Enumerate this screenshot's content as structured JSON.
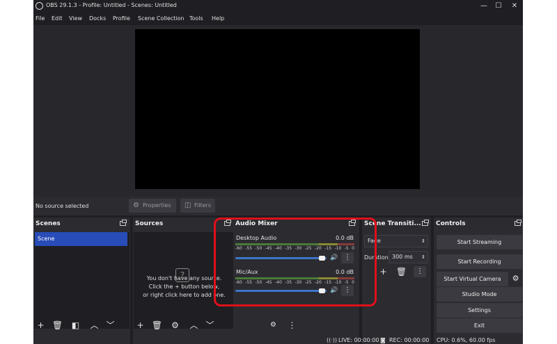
{
  "window": {
    "title": "OBS 29.1.3 - Profile: Untitled - Scenes: Untitled",
    "minimize": "—",
    "maximize": "☐",
    "close": "✕"
  },
  "menu": [
    "File",
    "Edit",
    "View",
    "Docks",
    "Profile",
    "Scene Collection",
    "Tools",
    "Help"
  ],
  "source_toolbar": {
    "no_source": "No source selected",
    "properties": "Properties",
    "filters": "Filters"
  },
  "scenes": {
    "title": "Scenes",
    "items": [
      "Scene"
    ]
  },
  "sources": {
    "title": "Sources",
    "empty_line1": "You don't have any source.",
    "empty_line2": "Click the + button below,",
    "empty_line3": "or right click here to add one."
  },
  "audio_mixer": {
    "title": "Audio Mixer",
    "scale": [
      "-60",
      "-55",
      "-50",
      "-45",
      "-40",
      "-35",
      "-30",
      "-25",
      "-20",
      "-15",
      "-10",
      "-5",
      "0"
    ],
    "channels": [
      {
        "name": "Desktop Audio",
        "db": "0.0 dB",
        "volume": 0.95
      },
      {
        "name": "Mic/Aux",
        "db": "0.0 dB",
        "volume": 0.95
      }
    ]
  },
  "transitions": {
    "title": "Scene Transiti...",
    "transition": "Fade",
    "duration_label": "Duration",
    "duration_value": "300 ms"
  },
  "controls": {
    "title": "Controls",
    "start_streaming": "Start Streaming",
    "start_recording": "Start Recording",
    "start_virtual_camera": "Start Virtual Camera",
    "studio_mode": "Studio Mode",
    "settings": "Settings",
    "exit": "Exit"
  },
  "status": {
    "live": "LIVE: 00:00:00",
    "rec": "REC: 00:00:00",
    "cpu": "CPU: 0.6%, 60.00 fps"
  },
  "colors": {
    "highlight": "#e0101a",
    "selected_scene": "#284cb8",
    "volume_slider": "#3c76c8"
  }
}
